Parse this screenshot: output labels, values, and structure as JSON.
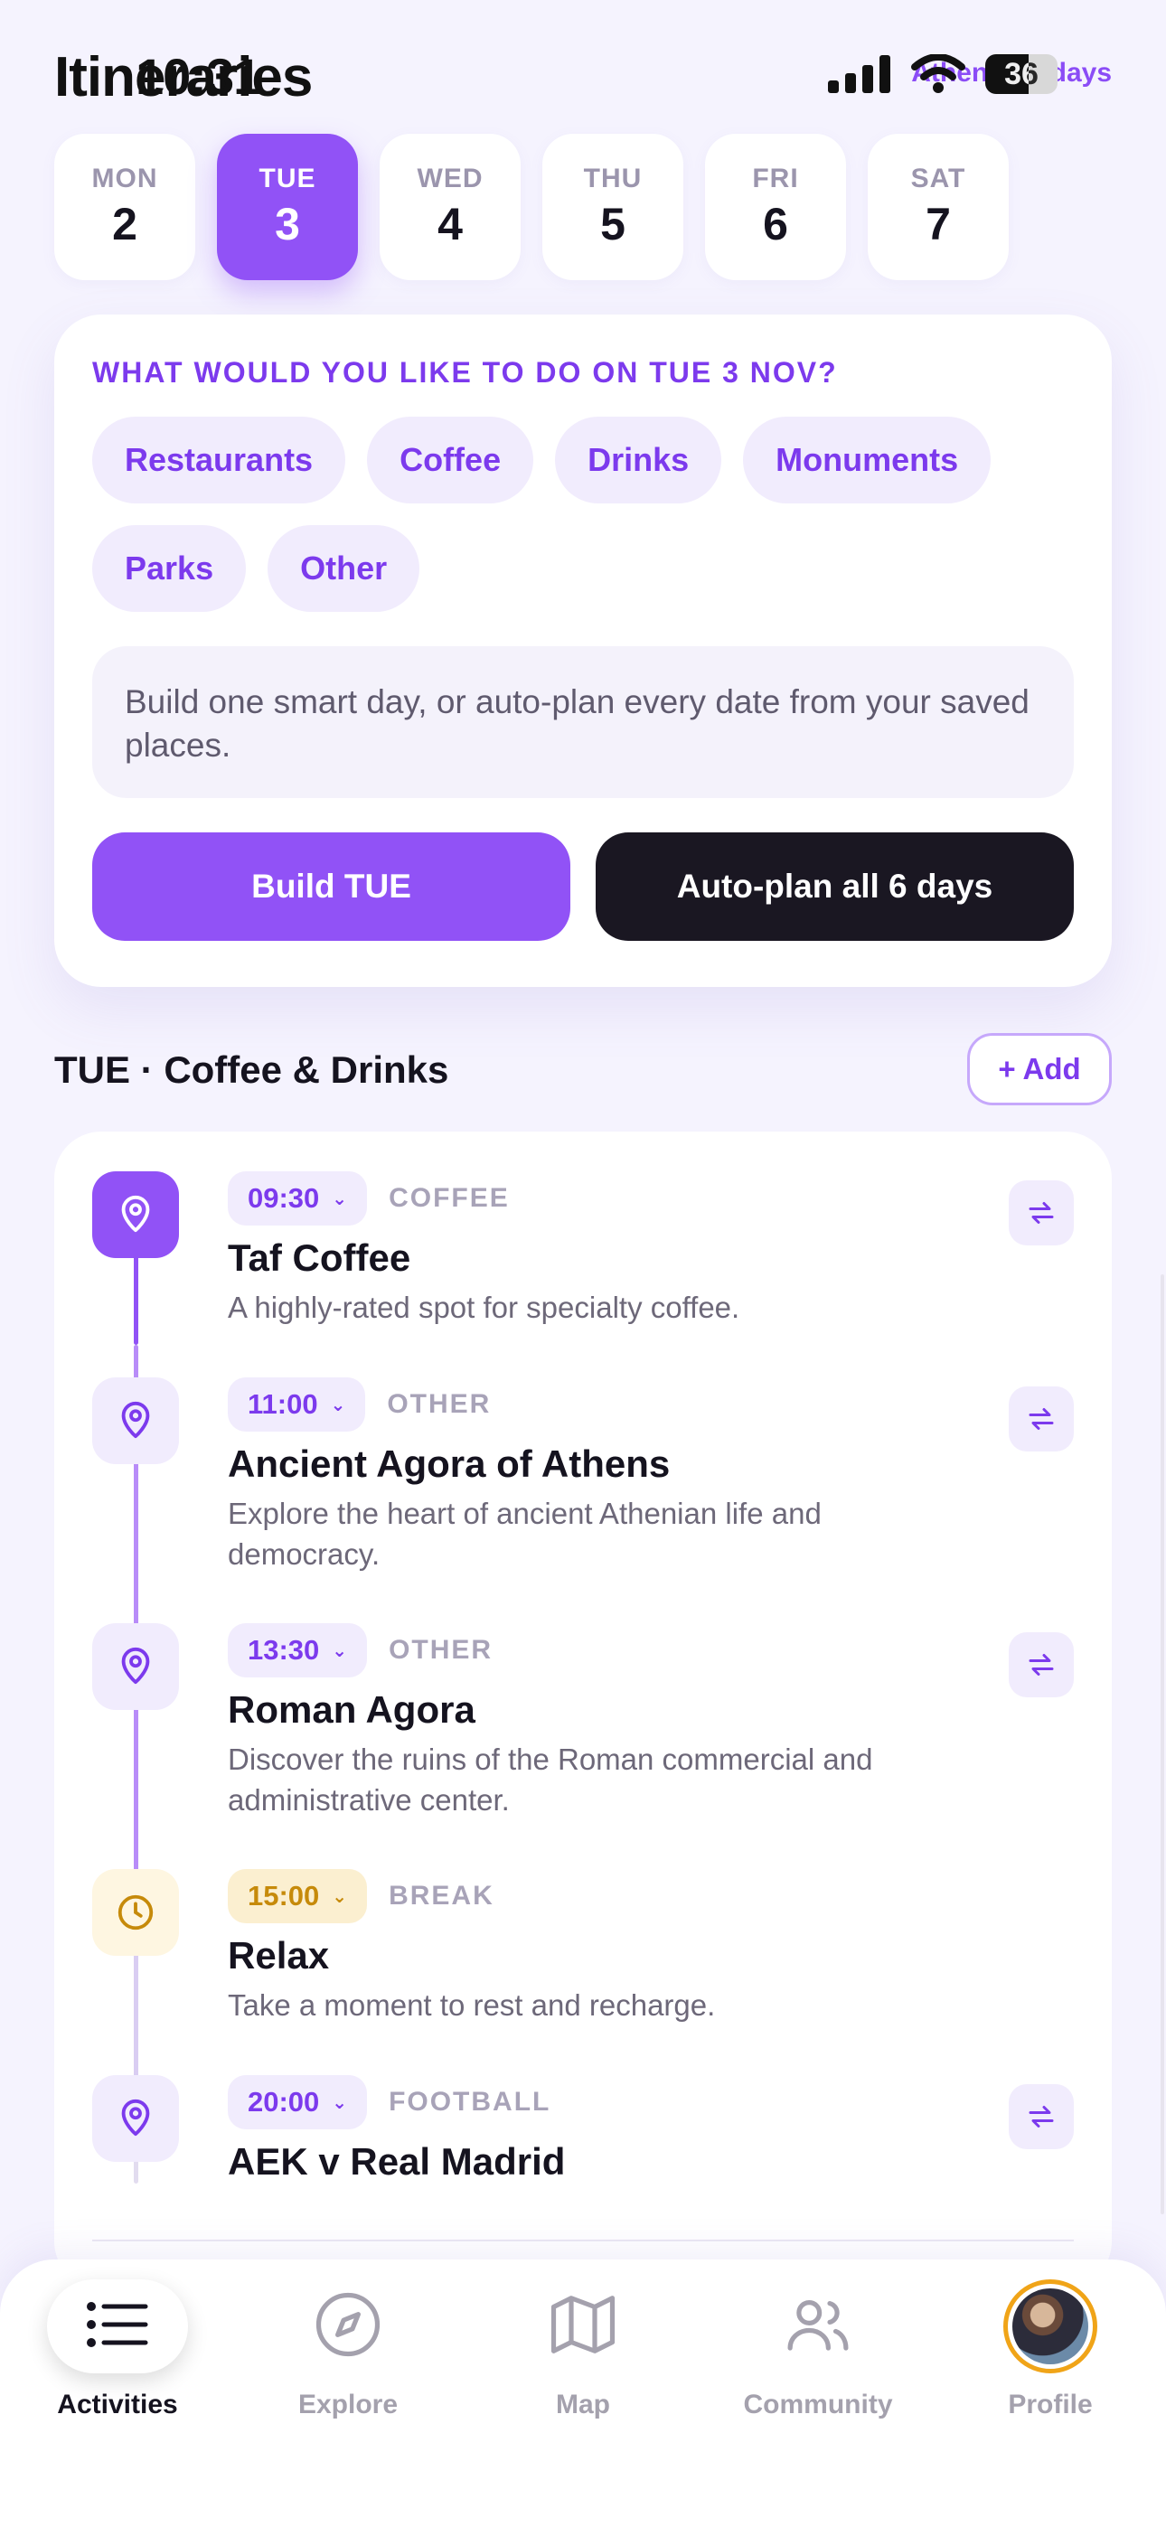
{
  "status": {
    "time": "10:31",
    "battery": "36"
  },
  "header": {
    "title": "Itineraries",
    "city_days": "Athens · 6 days"
  },
  "days": [
    {
      "dow": "MON",
      "num": "2"
    },
    {
      "dow": "TUE",
      "num": "3",
      "active": true
    },
    {
      "dow": "WED",
      "num": "4"
    },
    {
      "dow": "THU",
      "num": "5"
    },
    {
      "dow": "FRI",
      "num": "6"
    },
    {
      "dow": "SAT",
      "num": "7"
    }
  ],
  "planner": {
    "question": "WHAT WOULD YOU LIKE TO DO ON TUE 3 NOV?",
    "chips": [
      "Restaurants",
      "Coffee",
      "Drinks",
      "Monuments",
      "Parks",
      "Other"
    ],
    "hint": "Build one smart day, or auto-plan every date from your saved places.",
    "build_label": "Build TUE",
    "autoplan_label": "Auto-plan all 6 days"
  },
  "section": {
    "title": "TUE · Coffee & Drinks",
    "add_label": "+ Add"
  },
  "timeline": [
    {
      "time": "09:30",
      "category": "COFFEE",
      "title": "Taf Coffee",
      "desc": "A highly-rated spot for specialty coffee.",
      "icon": "map-pin-icon"
    },
    {
      "time": "11:00",
      "category": "OTHER",
      "title": "Ancient Agora of Athens",
      "desc": "Explore the heart of ancient Athenian life and democracy.",
      "icon": "map-pin-icon"
    },
    {
      "time": "13:30",
      "category": "OTHER",
      "title": "Roman Agora",
      "desc": "Discover the ruins of the Roman commercial and administrative center.",
      "icon": "map-pin-icon"
    },
    {
      "time": "15:00",
      "category": "BREAK",
      "title": "Relax",
      "desc": "Take a moment to rest and recharge.",
      "icon": "clock-icon"
    },
    {
      "time": "20:00",
      "category": "FOOTBALL",
      "title": "AEK v Real Madrid",
      "desc": "",
      "icon": "map-pin-icon"
    }
  ],
  "nav": [
    {
      "label": "Activities",
      "icon": "list-icon",
      "active": true
    },
    {
      "label": "Explore",
      "icon": "compass-icon"
    },
    {
      "label": "Map",
      "icon": "map-icon"
    },
    {
      "label": "Community",
      "icon": "users-icon"
    },
    {
      "label": "Profile",
      "icon": "avatar"
    }
  ],
  "colors": {
    "accent": "#9152f6",
    "accent_text": "#7c3aed",
    "dark": "#1a1722",
    "break": "#c68a0a"
  }
}
